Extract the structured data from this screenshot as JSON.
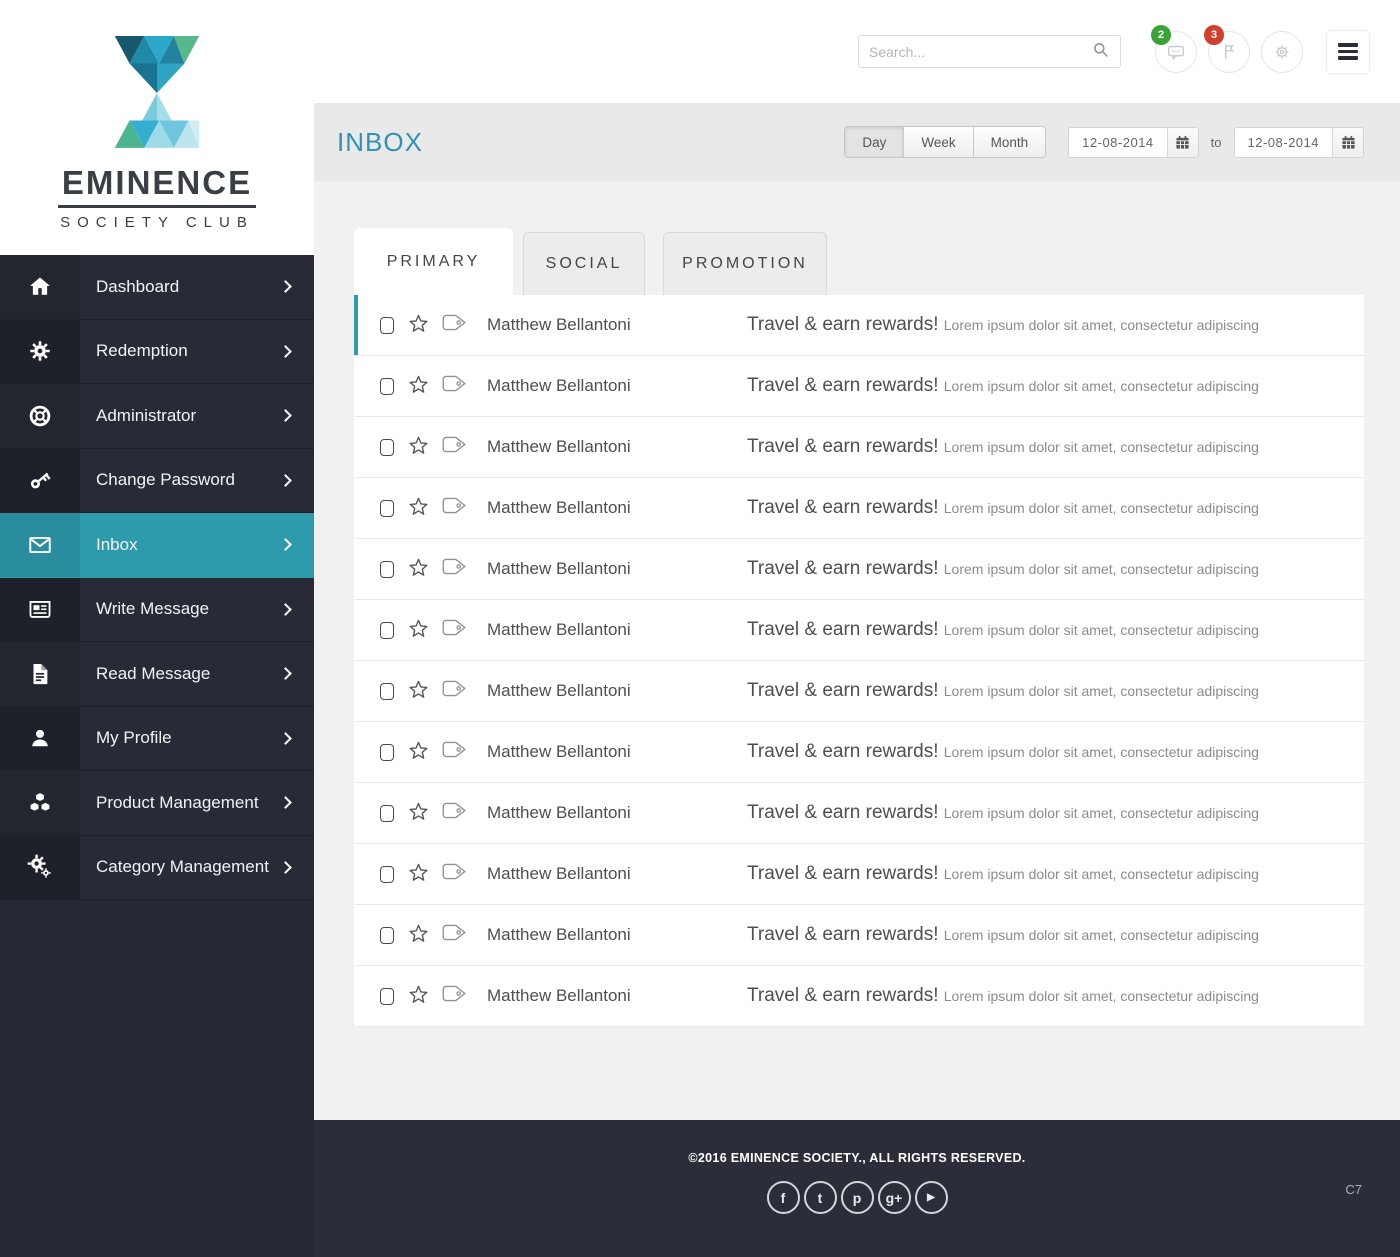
{
  "brand": {
    "name": "EMINENCE",
    "tagline": "SOCIETY CLUB"
  },
  "topbar": {
    "search": {
      "placeholder": "Search...",
      "icon": "search-icon"
    },
    "notifications": [
      {
        "name": "messages-button",
        "icon": "chat-icon",
        "badge": "2",
        "badge_color": "#3aa237"
      },
      {
        "name": "flags-button",
        "icon": "flag-icon",
        "badge": "3",
        "badge_color": "#d0402e"
      },
      {
        "name": "settings-button",
        "icon": "gear-outline-icon",
        "badge": null
      }
    ],
    "menu_button_icon": "hamburger-icon"
  },
  "page_header": {
    "title": "INBOX",
    "range_buttons": [
      {
        "label": "Day",
        "active": true
      },
      {
        "label": "Week",
        "active": false
      },
      {
        "label": "Month",
        "active": false
      }
    ],
    "date_from": "12-08-2014",
    "to_label": "to",
    "date_to": "12-08-2014"
  },
  "tabs": [
    {
      "label": "PRIMARY",
      "active": true
    },
    {
      "label": "SOCIAL",
      "active": false
    },
    {
      "label": "PROMOTION",
      "active": false
    }
  ],
  "sidebar_nav": {
    "items": [
      {
        "label": "Dashboard",
        "icon": "home-icon",
        "active": false
      },
      {
        "label": "Redemption",
        "icon": "gear-icon",
        "active": false
      },
      {
        "label": "Administrator",
        "icon": "life-ring-icon",
        "active": false
      },
      {
        "label": "Change Password",
        "icon": "key-icon",
        "active": false
      },
      {
        "label": "Inbox",
        "icon": "envelope-icon",
        "active": true
      },
      {
        "label": "Write Message",
        "icon": "newspaper-icon",
        "active": false
      },
      {
        "label": "Read Message",
        "icon": "document-icon",
        "active": false
      },
      {
        "label": "My Profile",
        "icon": "user-icon",
        "active": false
      },
      {
        "label": "Product Management",
        "icon": "cubes-icon",
        "active": false
      },
      {
        "label": "Category Management",
        "icon": "gears-icon",
        "active": false
      }
    ]
  },
  "inbox_list": {
    "emails": [
      {
        "sender": "Matthew Bellantoni",
        "subject": "Travel & earn rewards!",
        "snippet": "Lorem ipsum dolor sit amet, consectetur adipiscing",
        "highlighted": true
      },
      {
        "sender": "Matthew Bellantoni",
        "subject": "Travel & earn rewards!",
        "snippet": "Lorem ipsum dolor sit amet, consectetur adipiscing",
        "highlighted": false
      },
      {
        "sender": "Matthew Bellantoni",
        "subject": "Travel & earn rewards!",
        "snippet": "Lorem ipsum dolor sit amet, consectetur adipiscing",
        "highlighted": false
      },
      {
        "sender": "Matthew Bellantoni",
        "subject": "Travel & earn rewards!",
        "snippet": "Lorem ipsum dolor sit amet, consectetur adipiscing",
        "highlighted": false
      },
      {
        "sender": "Matthew Bellantoni",
        "subject": "Travel & earn rewards!",
        "snippet": "Lorem ipsum dolor sit amet, consectetur adipiscing",
        "highlighted": false
      },
      {
        "sender": "Matthew Bellantoni",
        "subject": "Travel & earn rewards!",
        "snippet": "Lorem ipsum dolor sit amet, consectetur adipiscing",
        "highlighted": false
      },
      {
        "sender": "Matthew Bellantoni",
        "subject": "Travel & earn rewards!",
        "snippet": "Lorem ipsum dolor sit amet, consectetur adipiscing",
        "highlighted": false
      },
      {
        "sender": "Matthew Bellantoni",
        "subject": "Travel & earn rewards!",
        "snippet": "Lorem ipsum dolor sit amet, consectetur adipiscing",
        "highlighted": false
      },
      {
        "sender": "Matthew Bellantoni",
        "subject": "Travel & earn rewards!",
        "snippet": "Lorem ipsum dolor sit amet, consectetur adipiscing",
        "highlighted": false
      },
      {
        "sender": "Matthew Bellantoni",
        "subject": "Travel & earn rewards!",
        "snippet": "Lorem ipsum dolor sit amet, consectetur adipiscing",
        "highlighted": false
      },
      {
        "sender": "Matthew Bellantoni",
        "subject": "Travel & earn rewards!",
        "snippet": "Lorem ipsum dolor sit amet, consectetur adipiscing",
        "highlighted": false
      },
      {
        "sender": "Matthew Bellantoni",
        "subject": "Travel & earn rewards!",
        "snippet": "Lorem ipsum dolor sit amet, consectetur adipiscing",
        "highlighted": false
      }
    ],
    "row_icons": [
      "checkbox",
      "star-icon",
      "tag-icon"
    ]
  },
  "footer": {
    "copyright": "©2016  EMINENCE SOCIETY., ALL RIGHTS RESERVED.",
    "social_icons": [
      {
        "name": "facebook-icon",
        "glyph": "f"
      },
      {
        "name": "twitter-icon",
        "glyph": "t"
      },
      {
        "name": "pinterest-icon",
        "glyph": "p"
      },
      {
        "name": "google-plus-icon",
        "glyph": "g+"
      },
      {
        "name": "youtube-icon",
        "glyph": "▶"
      }
    ],
    "corner_label": "C7"
  },
  "colors": {
    "accent_teal": "#2e9bac",
    "title_teal": "#2e93b4",
    "sidebar_bg": "#262933",
    "footer_bg": "#2b2e38",
    "badge_green": "#3aa237",
    "badge_red": "#d0402e"
  }
}
